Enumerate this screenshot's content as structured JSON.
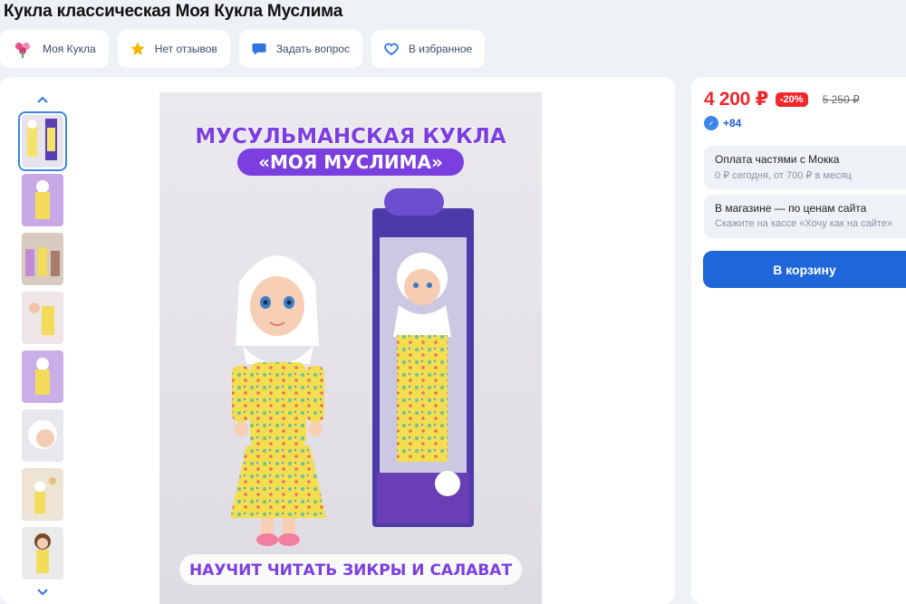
{
  "product": {
    "title": "Кукла классическая Моя Кукла Муслима"
  },
  "chips": {
    "brand": "Моя Кукла",
    "reviews": "Нет отзывов",
    "question": "Задать вопрос",
    "favorites": "В избранное"
  },
  "gallery": {
    "icons": [
      "chevron-up-icon",
      "chevron-down-icon"
    ],
    "thumb_count": 8,
    "selected_index": 0,
    "image_text": {
      "headline_1": "МУСУЛЬМАНСКАЯ КУКЛА",
      "headline_2": "«МОЯ МУСЛИМА»",
      "footer": "НАУЧИТ ЧИТАТЬ ЗИКРЫ И САЛАВАТ"
    }
  },
  "buy_box": {
    "price": "4 200 ₽",
    "discount": "-20%",
    "old_price": "5 250 ₽",
    "bonus": "+84",
    "installment_title": "Оплата частями с Мокка",
    "installment_sub": "0 ₽ сегодня, от 700 ₽ в месяц",
    "store_title": "В магазине — по ценам сайта",
    "store_sub": "Скажите на кассе «Хочу как на сайте»",
    "cart_button": "В корзину"
  },
  "colors": {
    "accent_blue": "#1f67d8",
    "price_red": "#f0282d",
    "purple_banner": "#7b3fe0",
    "background": "#eef1f6"
  }
}
